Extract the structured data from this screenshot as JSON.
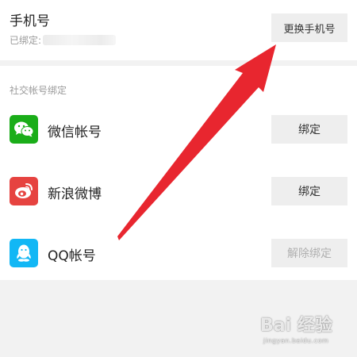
{
  "phone": {
    "title": "手机号",
    "bound_label": "已绑定:",
    "change_button": "更换手机号"
  },
  "social": {
    "section_label": "社交帐号绑定",
    "items": [
      {
        "label": "微信帐号",
        "button": "绑定",
        "icon": "wechat-icon",
        "color": "#1aad19",
        "button_enabled": true
      },
      {
        "label": "新浪微博",
        "button": "绑定",
        "icon": "weibo-icon",
        "color": "#e64340",
        "button_enabled": true
      },
      {
        "label": "QQ帐号",
        "button": "解除绑定",
        "icon": "qq-icon",
        "color": "#12b7f5",
        "button_enabled": false
      }
    ]
  },
  "annotation": {
    "arrow_color": "#e8262f"
  },
  "watermark": {
    "brand": "Bai 经验",
    "sub": "jingyan.baidu.com"
  }
}
